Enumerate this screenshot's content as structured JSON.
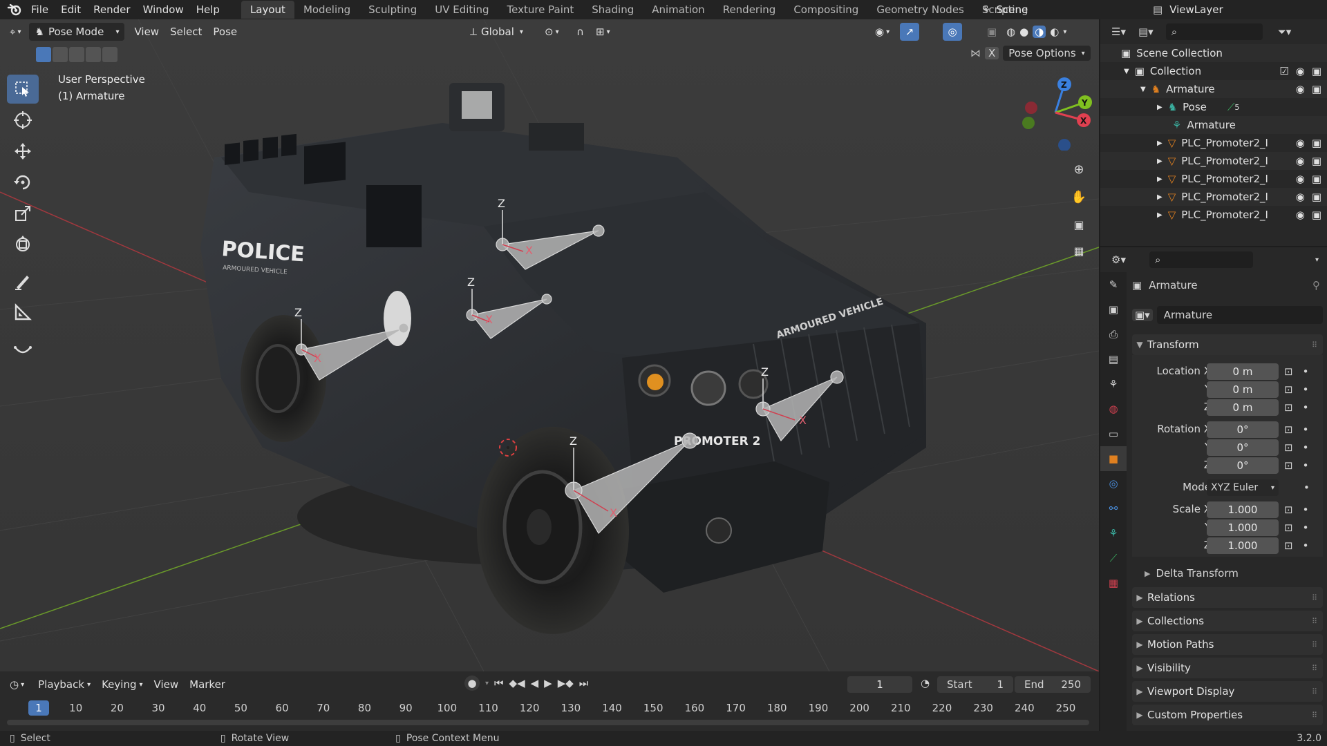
{
  "topbar": {
    "menus": [
      "File",
      "Edit",
      "Render",
      "Window",
      "Help"
    ],
    "workspaces": [
      "Layout",
      "Modeling",
      "Sculpting",
      "UV Editing",
      "Texture Paint",
      "Shading",
      "Animation",
      "Rendering",
      "Compositing",
      "Geometry Nodes",
      "Scripting"
    ],
    "active_workspace": "Layout",
    "scene_name": "Scene",
    "view_layer": "ViewLayer"
  },
  "viewport": {
    "mode": "Pose Mode",
    "menus": [
      "View",
      "Select",
      "Pose"
    ],
    "orientation": "Global",
    "pose_options": "Pose Options",
    "x_mirror": "X",
    "perspective_label": "User Perspective",
    "object_label": "(1) Armature",
    "gizmo_axes": [
      "Z",
      "Y",
      "X"
    ],
    "vehicle_text": {
      "police": "POLICE",
      "armoured": "ARMOURED VEHICLE",
      "promoter": "PROMOTER 2",
      "hood": "ARMOURED VEHICLE"
    },
    "bone_axes": [
      "Z",
      "X"
    ],
    "tools": [
      "select-box",
      "cursor",
      "move",
      "rotate",
      "scale",
      "transform",
      "annotate",
      "measure",
      "relax"
    ]
  },
  "timeline": {
    "menus": [
      "Playback",
      "Keying",
      "View",
      "Marker"
    ],
    "current_frame": "1",
    "start_label": "Start",
    "start": "1",
    "end_label": "End",
    "end": "250",
    "ruler": [
      "1",
      "10",
      "20",
      "30",
      "40",
      "50",
      "60",
      "70",
      "80",
      "90",
      "100",
      "110",
      "120",
      "130",
      "140",
      "150",
      "160",
      "170",
      "180",
      "190",
      "200",
      "210",
      "220",
      "230",
      "240",
      "250"
    ]
  },
  "statusbar": {
    "select": "Select",
    "rotate": "Rotate View",
    "context": "Pose Context Menu",
    "version": "3.2.0"
  },
  "outliner": {
    "scene_collection": "Scene Collection",
    "collection": "Collection",
    "armature": "Armature",
    "pose": "Pose",
    "pose_count": "5",
    "armature_data": "Armature",
    "meshes": [
      "PLC_Promoter2_I",
      "PLC_Promoter2_I",
      "PLC_Promoter2_I",
      "PLC_Promoter2_I",
      "PLC_Promoter2_I"
    ]
  },
  "properties": {
    "object_name": "Armature",
    "data_name": "Armature",
    "transform_label": "Transform",
    "location_label": "Location X",
    "rotation_label": "Rotation X",
    "scale_label": "Scale X",
    "y_label": "Y",
    "z_label": "Z",
    "mode_label": "Mode",
    "location": [
      "0 m",
      "0 m",
      "0 m"
    ],
    "rotation": [
      "0°",
      "0°",
      "0°"
    ],
    "rotation_mode": "XYZ Euler",
    "scale": [
      "1.000",
      "1.000",
      "1.000"
    ],
    "delta_transform": "Delta Transform",
    "panels": [
      "Relations",
      "Collections",
      "Motion Paths",
      "Visibility",
      "Viewport Display",
      "Custom Properties"
    ]
  },
  "colors": {
    "accent": "#4a78b8",
    "axis_x": "#e04050",
    "axis_y": "#80c020",
    "axis_z": "#3a80e0",
    "orange": "#e08020"
  }
}
